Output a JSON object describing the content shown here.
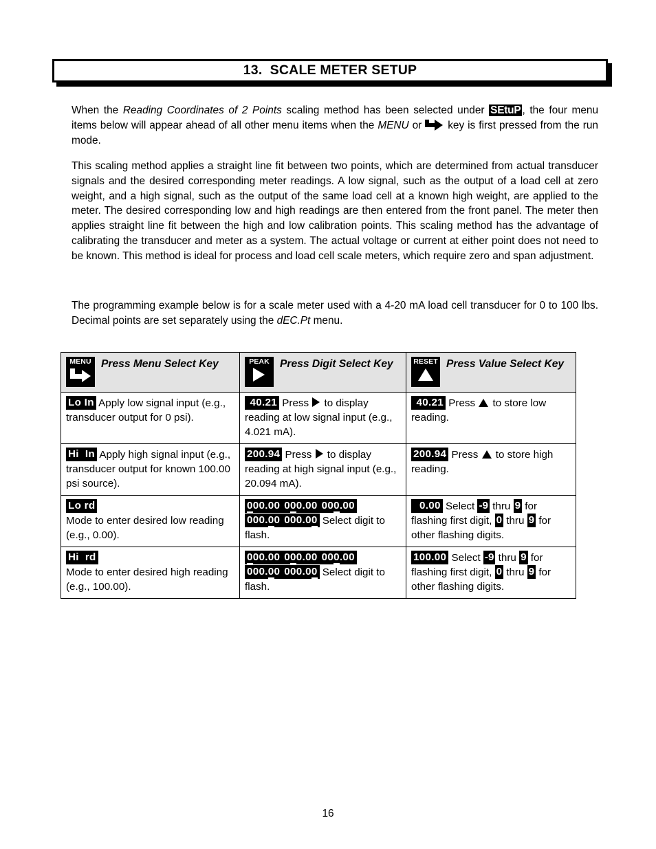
{
  "heading": {
    "number": "13.",
    "title": "13.  SCALE METER SETUP"
  },
  "paragraphs": {
    "p1_part1": "When the ",
    "p1_italic1": "Reading Coordinates of 2 Points",
    "p1_part2": " scaling method has been selected under ",
    "p1_badge": "SEtuP",
    "p1_part3": ", the four menu items below will appear ahead of all other menu items when the ",
    "p1_italic2": "MENU",
    "p1_part4": " or ",
    "p1_part5": " key is first pressed from the run mode.",
    "p2": "This scaling method applies a straight line fit between two points, which are determined from actual transducer signals and the desired corresponding meter readings. A low signal, such as the output of a load cell at zero weight, and a high signal, such as the output of the same load cell at a known high weight, are applied to the meter. The desired corresponding low and high readings are then entered from the front panel. The meter then applies straight line fit between the high and low calibration points. This scaling method has the advantage of calibrating the transducer and meter as a system. The actual voltage or current at either point does not need to be known. This method is ideal for process and load cell scale meters, which require zero and span adjustment.",
    "p3_part1": "The programming example below is for a scale meter used with a 4-20 mA load cell transducer for 0 to 100 lbs. Decimal points are set separately using the ",
    "p3_italic": "dEC.Pt",
    "p3_part2": " menu."
  },
  "table": {
    "header": [
      {
        "key_label": "MENU",
        "key_icon": "hooked-right-arrow-icon",
        "text": "Press Menu Select Key"
      },
      {
        "key_label": "PEAK",
        "key_icon": "right-triangle-icon",
        "text": "Press Digit Select Key"
      },
      {
        "key_label": "RESET",
        "key_icon": "up-triangle-icon",
        "text": "Press Value Select Key"
      }
    ],
    "rows": [
      {
        "col1": {
          "display": "Lo In",
          "text": " Apply low signal input (e.g., transducer output for 0 psi)."
        },
        "col2": {
          "display": " 40.21",
          "text_before": " Press ",
          "arrow": "right-triangle-icon",
          "text_after": " to display reading at low signal input (e.g., 4.021 mA)."
        },
        "col3": {
          "display": " 40.21",
          "text_before": " Press ",
          "arrow": "up-triangle-icon",
          "text_after": " to store low reading."
        }
      },
      {
        "col1": {
          "display": "Hi  In",
          "text": " Apply high signal input (e.g., transducer output for known 100.00 psi source)."
        },
        "col2": {
          "display": "200.94",
          "text_before": " Press ",
          "arrow": "right-triangle-icon",
          "text_after": " to display reading at high signal input (e.g., 20.094 mA)."
        },
        "col3": {
          "display": "200.94",
          "text_before": " Press ",
          "arrow": "up-triangle-icon",
          "text_after": " to store high reading."
        }
      },
      {
        "col1": {
          "display": "Lo rd",
          "text": "Mode to enter desired low reading (e.g., 0.00)."
        },
        "col2": {
          "digits_base": "000.00",
          "flash_positions": [
            0,
            1,
            2,
            3,
            4
          ],
          "text_after": " Select digit to flash."
        },
        "col3": {
          "display": "  0.00",
          "t1": " Select ",
          "b1": "-9",
          "t2": " thru ",
          "b2": "9",
          "t3": " for flashing first digit, ",
          "b3": "0",
          "t4": " thru ",
          "b4": "9",
          "t5": " for other flashing digits."
        }
      },
      {
        "col1": {
          "display": "Hi  rd",
          "text": "Mode to enter desired high reading (e.g., 100.00)."
        },
        "col2": {
          "digits_base": "000.00",
          "flash_positions": [
            0,
            1,
            2,
            3,
            4
          ],
          "text_after": " Select digit to flash."
        },
        "col3": {
          "display": "100.00",
          "t1": " Select ",
          "b1": "-9",
          "t2": " thru ",
          "b2": "9",
          "t3": " for flashing first digit, ",
          "b3": "0",
          "t4": " thru ",
          "b4": "9",
          "t5": " for other flashing digits."
        }
      }
    ]
  },
  "footer": {
    "page_number": "16"
  }
}
